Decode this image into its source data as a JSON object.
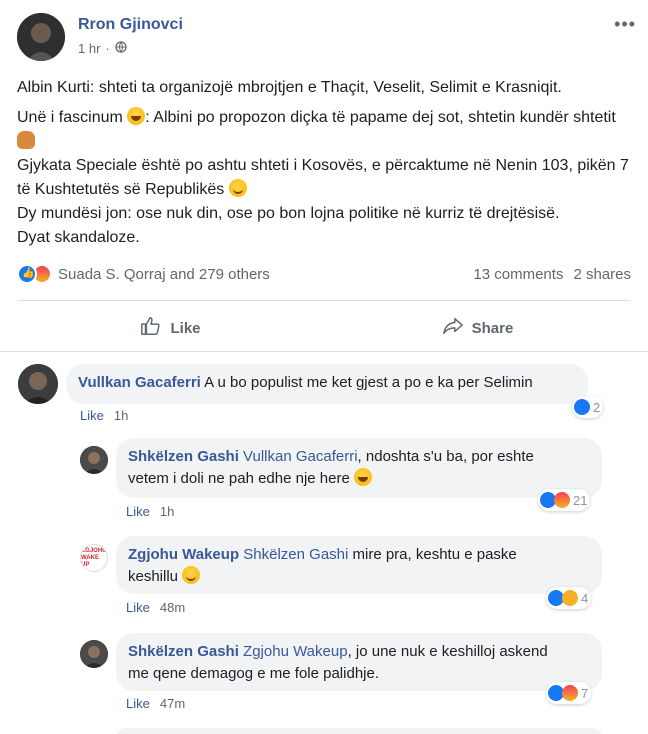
{
  "post": {
    "author": "Rron Gjinovci",
    "time": "1 hr",
    "privacy_icon": "globe-icon",
    "more_label": "•••",
    "lines": {
      "l1": "Albin Kurti: shteti ta organizojë mbrojtjen e Thaçit, Veselit, Selimit e Krasniqit.",
      "l2a": "Unë i fascinum ",
      "l2b": ": Albini po propozon diçka të papame dej sot, shtetin kundër shtetit ",
      "l3": "Gjykata Speciale është po ashtu shteti i Kosovës, e përcaktume në Nenin 103, pikën 7 të Kushtetutës së Republikës ",
      "l4": "Dy mundësi jon: ose nuk din, ose po bon lojna politike në kurriz të drejtësisë.",
      "l5": "Dyat skandaloze."
    },
    "reactions_text": "Suada S. Qorraj and 279 others",
    "comments_count": "13 comments",
    "shares_count": "2 shares",
    "like_label": "Like",
    "share_label": "Share"
  },
  "comments": [
    {
      "name": "Vullkan Gacaferri",
      "mention": "",
      "text": " A u bo populist me ket gjest a po e ka per Selimin",
      "like": "Like",
      "time": "1h",
      "react_count": "2"
    },
    {
      "name": "Shkëlzen Gashi",
      "mention": "Vullkan Gacaferri",
      "text1": ", ndoshta s'u ba, por eshte",
      "text2": "vetem i doli ne pah edhe nje here",
      "like": "Like",
      "time": "1h",
      "react_count": "21"
    },
    {
      "name": "Zgjohu Wakeup",
      "mention": "Shkëlzen Gashi",
      "text1": " mire pra, keshtu e paske",
      "text2": "keshillu",
      "like": "Like",
      "time": "48m",
      "react_count": "4",
      "logo_top": "ZGJOHU",
      "logo_bottom": "WAKE UP"
    },
    {
      "name": "Shkëlzen Gashi",
      "mention": "Zgjohu Wakeup",
      "text1": ", jo une nuk e keshilloj askend",
      "text2": "me qene demagog e me fole palidhje.",
      "like": "Like",
      "time": "47m",
      "react_count": "7"
    }
  ],
  "colors": {
    "link": "#385898",
    "like_blue": "#1877f2",
    "meta_gray": "#606770",
    "bubble_bg": "#f2f3f5"
  }
}
